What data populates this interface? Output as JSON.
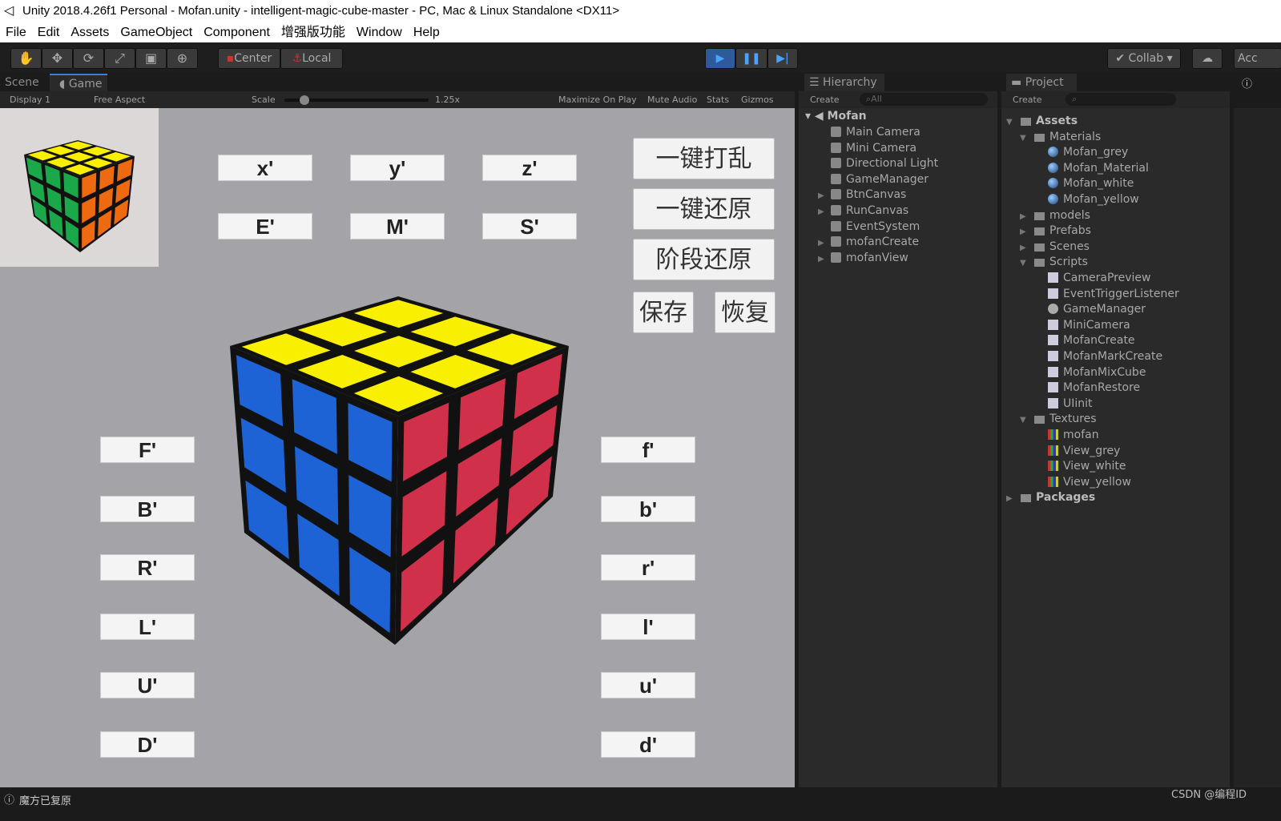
{
  "window": {
    "title": "Unity 2018.4.26f1 Personal - Mofan.unity - intelligent-magic-cube-master - PC, Mac & Linux Standalone <DX11>"
  },
  "menu": [
    "File",
    "Edit",
    "Assets",
    "GameObject",
    "Component",
    "增强版功能",
    "Window",
    "Help"
  ],
  "toolbar": {
    "tools": [
      "hand-icon",
      "move-icon",
      "rotate-icon",
      "scale-icon",
      "rect-icon",
      "transform-icon"
    ],
    "center": "Center",
    "local": "Local",
    "collab": "Collab",
    "account": "Acc"
  },
  "tabs": {
    "scene": "Scene",
    "game": "Game",
    "hierarchy": "Hierarchy",
    "project": "Project"
  },
  "gamebar": {
    "display": "Display 1",
    "aspect": "Free Aspect",
    "scale_label": "Scale",
    "scale_value": "1.25x",
    "scale_fraction": 0.05,
    "maximize": "Maximize On Play",
    "mute": "Mute Audio",
    "stats": "Stats",
    "gizmos": "Gizmos"
  },
  "game": {
    "top_buttons": [
      "x'",
      "y'",
      "z'",
      "E'",
      "M'",
      "S'"
    ],
    "left_buttons": [
      "F'",
      "B'",
      "R'",
      "L'",
      "U'",
      "D'"
    ],
    "right_buttons": [
      "f'",
      "b'",
      "r'",
      "l'",
      "u'",
      "d'"
    ],
    "action_buttons": [
      "一键打乱",
      "一键还原",
      "阶段还原"
    ],
    "save": "保存",
    "restore": "恢复",
    "cube_colors": {
      "top": "#f8f000",
      "left": "#1e63d6",
      "right": "#d0304a",
      "mini_left": "#1aa84a",
      "mini_right": "#ee6a10"
    }
  },
  "hierarchy": {
    "create": "Create",
    "search_placeholder": "All",
    "scene": "Mofan",
    "items": [
      {
        "label": "Main Camera",
        "expand": false
      },
      {
        "label": "Mini Camera",
        "expand": false
      },
      {
        "label": "Directional Light",
        "expand": false
      },
      {
        "label": "GameManager",
        "expand": false
      },
      {
        "label": "BtnCanvas",
        "expand": true
      },
      {
        "label": "RunCanvas",
        "expand": true
      },
      {
        "label": "EventSystem",
        "expand": false
      },
      {
        "label": "mofanCreate",
        "expand": true
      },
      {
        "label": "mofanView",
        "expand": true
      }
    ]
  },
  "project": {
    "create": "Create",
    "items": [
      {
        "label": "Assets",
        "level": 0,
        "type": "folder",
        "open": true
      },
      {
        "label": "Materials",
        "level": 1,
        "type": "folder",
        "open": true
      },
      {
        "label": "Mofan_grey",
        "level": 2,
        "type": "material"
      },
      {
        "label": "Mofan_Material",
        "level": 2,
        "type": "material"
      },
      {
        "label": "Mofan_white",
        "level": 2,
        "type": "material"
      },
      {
        "label": "Mofan_yellow",
        "level": 2,
        "type": "material"
      },
      {
        "label": "models",
        "level": 1,
        "type": "folder",
        "open": false
      },
      {
        "label": "Prefabs",
        "level": 1,
        "type": "folder",
        "open": false
      },
      {
        "label": "Scenes",
        "level": 1,
        "type": "folder",
        "open": false
      },
      {
        "label": "Scripts",
        "level": 1,
        "type": "folder",
        "open": true
      },
      {
        "label": "CameraPreview",
        "level": 2,
        "type": "script"
      },
      {
        "label": "EventTriggerListener",
        "level": 2,
        "type": "script"
      },
      {
        "label": "GameManager",
        "level": 2,
        "type": "gear"
      },
      {
        "label": "MiniCamera",
        "level": 2,
        "type": "script"
      },
      {
        "label": "MofanCreate",
        "level": 2,
        "type": "script"
      },
      {
        "label": "MofanMarkCreate",
        "level": 2,
        "type": "script"
      },
      {
        "label": "MofanMixCube",
        "level": 2,
        "type": "script"
      },
      {
        "label": "MofanRestore",
        "level": 2,
        "type": "script"
      },
      {
        "label": "UIinit",
        "level": 2,
        "type": "script"
      },
      {
        "label": "Textures",
        "level": 1,
        "type": "folder",
        "open": true
      },
      {
        "label": "mofan",
        "level": 2,
        "type": "texture"
      },
      {
        "label": "View_grey",
        "level": 2,
        "type": "texture"
      },
      {
        "label": "View_white",
        "level": 2,
        "type": "texture"
      },
      {
        "label": "View_yellow",
        "level": 2,
        "type": "texture"
      },
      {
        "label": "Packages",
        "level": 0,
        "type": "folder",
        "open": false
      }
    ]
  },
  "status": {
    "message": "魔方已复原",
    "watermark": "CSDN @编程ID"
  }
}
